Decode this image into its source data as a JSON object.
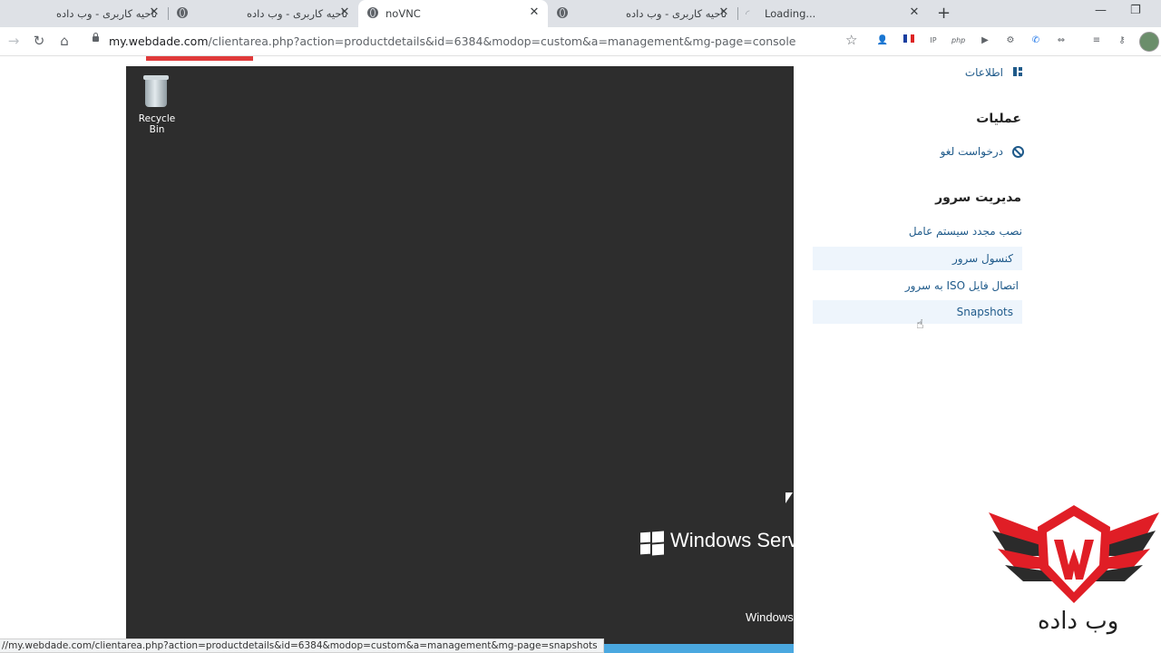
{
  "tabs": [
    {
      "title": "ناحیه کاربری - وب داده",
      "active": false
    },
    {
      "title": "ناحیه کاربری - وب داده",
      "active": false
    },
    {
      "title": "noVNC",
      "active": true
    },
    {
      "title": "ناحیه کاربری - وب داده",
      "active": false
    },
    {
      "title": "Loading...",
      "active": false
    }
  ],
  "address_bar": {
    "host": "my.webdade.com",
    "path": "/clientarea.php?action=productdetails&id=6384&modop=custom&a=management&mg-page=console"
  },
  "extensions": [
    "user-icon",
    "flag-icon",
    "ip-icon",
    "php-icon",
    "play-icon",
    "gear-icon",
    "phone-icon",
    "arrows-icon",
    "playlist-icon",
    "key-icon"
  ],
  "console": {
    "recycle_bin_label": "Recycle Bin",
    "windows_brand": "Windows Serve",
    "windows_bottom": "Windows"
  },
  "sidebar": {
    "info_link": "اطلاعات",
    "operations_heading": "عملیات",
    "cancel_request": "درخواست لغو",
    "server_management_heading": "مدیریت سرور",
    "items": [
      {
        "label": "نصب مجدد سیستم عامل",
        "highlighted": false
      },
      {
        "label": "کنسول سرور",
        "highlighted": true
      },
      {
        "label": "اتصال فایل ISO به سرور",
        "highlighted": false
      },
      {
        "label": "Snapshots",
        "highlighted": true
      }
    ]
  },
  "brand": {
    "logo_text": "وب داده",
    "colors": {
      "red": "#e01e26",
      "dark": "#2b2b2b"
    }
  },
  "status_bar": {
    "url": "//my.webdade.com/clientarea.php?action=productdetails&id=6384&modop=custom&a=management&mg-page=snapshots"
  }
}
